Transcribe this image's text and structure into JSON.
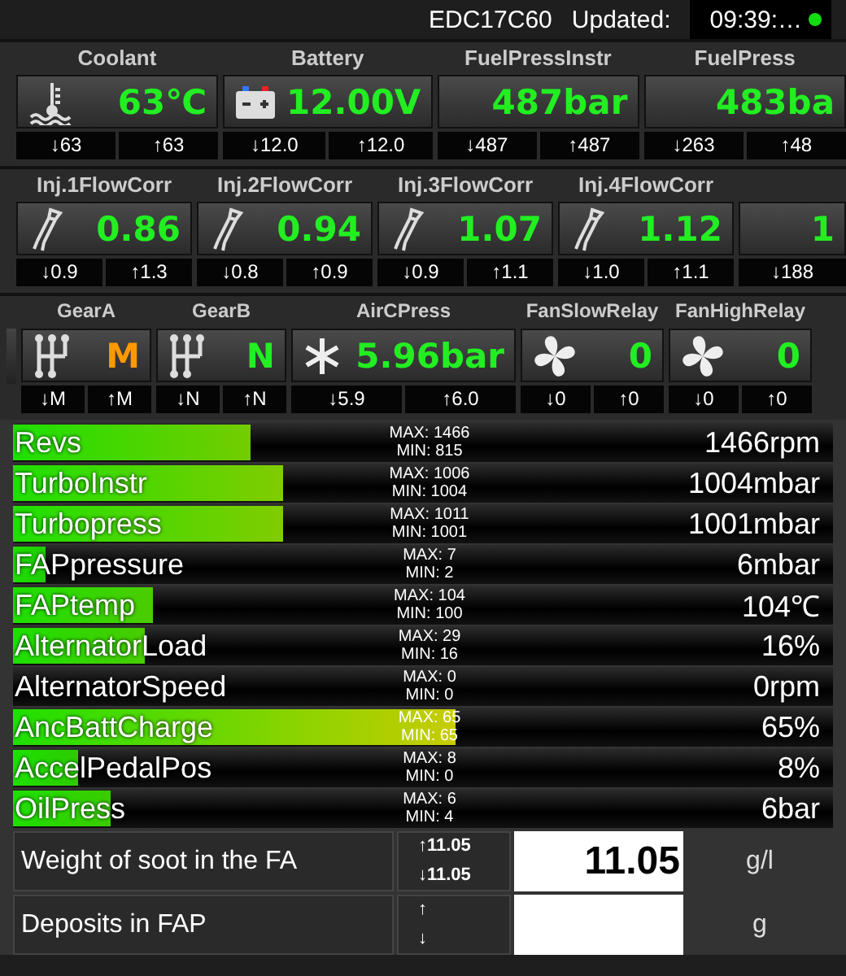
{
  "header": {
    "ecu": "EDC17C60",
    "updated_label": "Updated:",
    "time": "09:39:…"
  },
  "gauge_rows": [
    {
      "tiles": [
        {
          "kind": "coolant",
          "label": "Coolant",
          "value": "63℃",
          "color": "#22ee22",
          "min": "↓63",
          "max": "↑63"
        },
        {
          "kind": "battery",
          "label": "Battery",
          "value": "12.00V",
          "color": "#22ee22",
          "min": "↓12.0",
          "max": "↑12.0"
        },
        {
          "kind": "plain",
          "label": "FuelPressInstr",
          "value": "487bar",
          "color": "#22ee22",
          "min": "↓487",
          "max": "↑487"
        },
        {
          "kind": "plain",
          "label": "FuelPress",
          "value": "483ba",
          "color": "#22ee22",
          "min": "↓263",
          "max": "↑48"
        }
      ]
    },
    {
      "tiles": [
        {
          "kind": "injector",
          "label": "Inj.1FlowCorr",
          "value": "0.86",
          "color": "#22ee22",
          "min": "↓0.9",
          "max": "↑1.3"
        },
        {
          "kind": "injector",
          "label": "Inj.2FlowCorr",
          "value": "0.94",
          "color": "#22ee22",
          "min": "↓0.8",
          "max": "↑0.9"
        },
        {
          "kind": "injector",
          "label": "Inj.3FlowCorr",
          "value": "1.07",
          "color": "#22ee22",
          "min": "↓0.9",
          "max": "↑1.1"
        },
        {
          "kind": "injector",
          "label": "Inj.4FlowCorr",
          "value": "1.12",
          "color": "#22ee22",
          "min": "↓1.0",
          "max": "↑1.1"
        },
        {
          "kind": "plain",
          "value": "1",
          "color": "#22ee22",
          "min": "↓188"
        }
      ]
    },
    {
      "tiles": [
        {
          "kind": "gear",
          "label": "GearA",
          "value": "M",
          "color": "#ff9900",
          "min": "↓M",
          "max": "↑M"
        },
        {
          "kind": "gear",
          "label": "GearB",
          "value": "N",
          "color": "#22ee22",
          "min": "↓N",
          "max": "↑N"
        },
        {
          "kind": "ac",
          "label": "AirCPress",
          "value": "5.96bar",
          "color": "#22ee22",
          "min": "↓5.9",
          "max": "↑6.0"
        },
        {
          "kind": "fan",
          "label": "FanSlowRelay",
          "value": "0",
          "color": "#22ee22",
          "min": "↓0",
          "max": "↑0"
        },
        {
          "kind": "fan",
          "label": "FanHighRelay",
          "value": "0",
          "color": "#22ee22",
          "min": "↓0",
          "max": "↑0"
        }
      ]
    }
  ],
  "bars": [
    {
      "label": "Revs",
      "max": "MAX: 1466",
      "min": "MIN: 815",
      "value": "1466rpm",
      "level": 0.29
    },
    {
      "label": "TurboInstr",
      "max": "MAX: 1006",
      "min": "MIN: 1004",
      "value": "1004mbar",
      "level": 0.33
    },
    {
      "label": "Turbopress",
      "max": "MAX: 1011",
      "min": "MIN: 1001",
      "value": "1001mbar",
      "level": 0.33
    },
    {
      "label": "FAPpressure",
      "max": "MAX: 7",
      "min": "MIN: 2",
      "value": "6mbar",
      "level": 0.04
    },
    {
      "label": "FAPtemp",
      "max": "MAX: 104",
      "min": "MIN: 100",
      "value": "104℃",
      "level": 0.17
    },
    {
      "label": "AlternatorLoad",
      "max": "MAX: 29",
      "min": "MIN: 16",
      "value": "16%",
      "level": 0.16
    },
    {
      "label": "AlternatorSpeed",
      "max": "MAX: 0",
      "min": "MIN: 0",
      "value": "0rpm"
    },
    {
      "label": "AncBattCharge",
      "max": "MAX: 65",
      "min": "MIN: 65",
      "value": "65%",
      "level": 0.54
    },
    {
      "label": "AccelPedalPos",
      "max": "MAX: 8",
      "min": "MIN: 0",
      "value": "8%",
      "level": 0.08
    },
    {
      "label": "OilPress",
      "max": "MAX: 6",
      "min": "MIN: 4",
      "value": "6bar",
      "level": 0.12
    }
  ],
  "table": [
    {
      "label": "Weight of soot in the FA",
      "up": "↑11.05",
      "down": "↓11.05",
      "value": "11.05",
      "unit": "g/l"
    },
    {
      "label": "Deposits in FAP",
      "up": "↑",
      "down": "↓",
      "unit": "g"
    }
  ]
}
